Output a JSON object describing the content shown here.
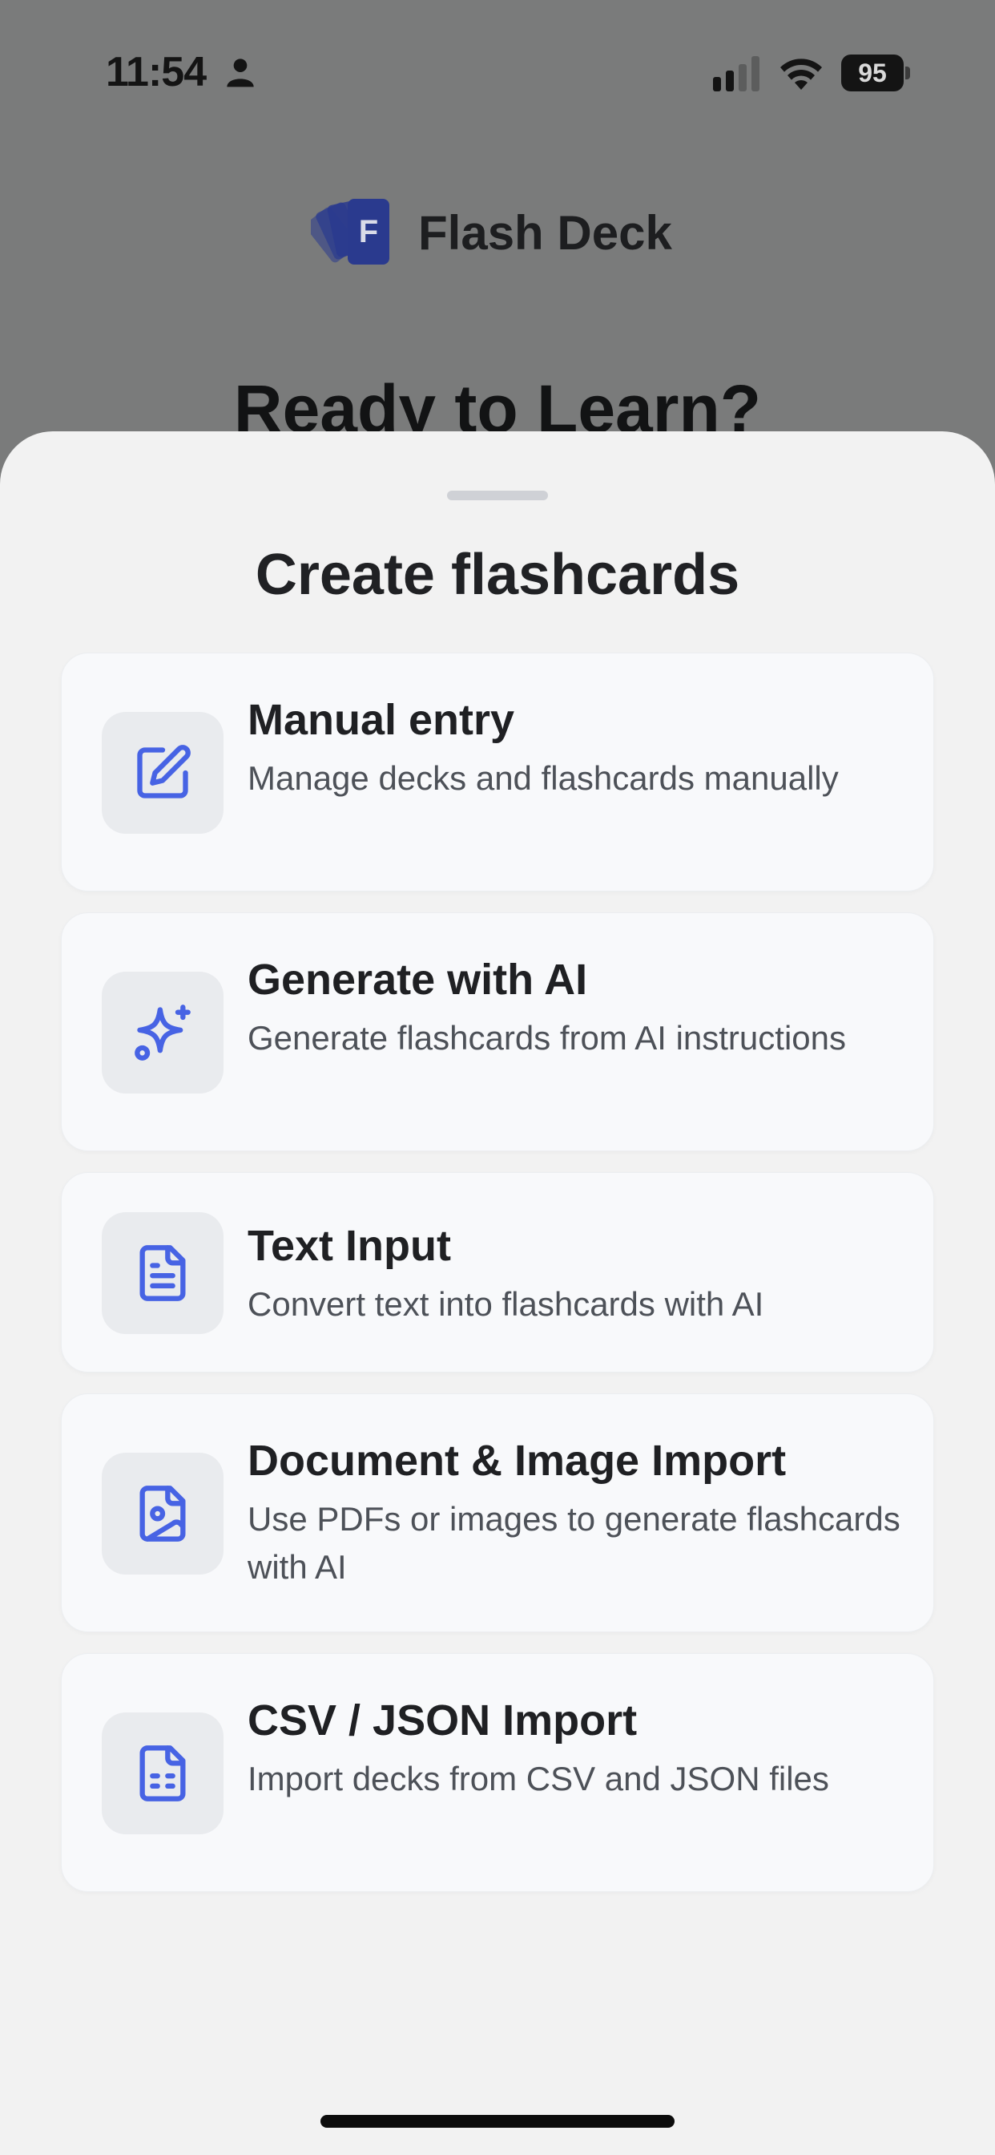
{
  "status_bar": {
    "time": "11:54",
    "battery": "95"
  },
  "app": {
    "name": "Flash Deck",
    "logo_letter": "F",
    "heading": "Ready to Learn?"
  },
  "sheet": {
    "title": "Create flashcards",
    "options": [
      {
        "icon": "edit-icon",
        "title": "Manual entry",
        "description": "Manage decks and flashcards manually"
      },
      {
        "icon": "sparkles-icon",
        "title": "Generate with AI",
        "description": "Generate flashcards from AI instructions"
      },
      {
        "icon": "text-document-icon",
        "title": "Text Input",
        "description": "Convert text into flashcards with AI"
      },
      {
        "icon": "image-document-icon",
        "title": "Document & Image Import",
        "description": "Use PDFs or images to generate flashcards with AI"
      },
      {
        "icon": "spreadsheet-document-icon",
        "title": "CSV / JSON Import",
        "description": "Import decks from CSV and JSON files"
      }
    ]
  },
  "colors": {
    "accent": "#4763e4",
    "logo": "#2a3a8e",
    "overlay": "#7a7b7b",
    "sheet_bg": "#f2f2f2",
    "card_bg": "#f8f9fb",
    "icon_bg": "#e9ebee"
  }
}
